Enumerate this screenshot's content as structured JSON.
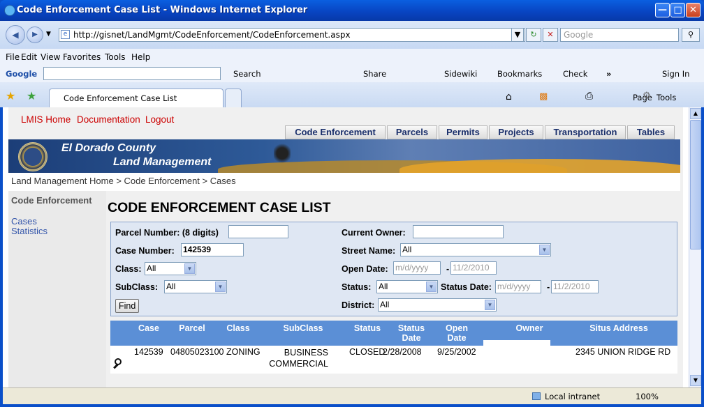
{
  "window": {
    "title": "Code Enforcement Case List - Windows Internet Explorer"
  },
  "address": {
    "url": "http://gisnet/LandMgmt/CodeEnforcement/CodeEnforcement.aspx",
    "search_placeholder": "Google"
  },
  "menu": [
    "File",
    "Edit",
    "View",
    "Favorites",
    "Tools",
    "Help"
  ],
  "google_bar": {
    "logo": "Google",
    "items": [
      "Search",
      "Share",
      "Sidewiki",
      "Bookmarks",
      "Check",
      "»",
      "Sign In"
    ]
  },
  "tab": {
    "title": "Code Enforcement Case List",
    "page_label": "Page",
    "tools_label": "Tools"
  },
  "top_links": [
    "LMIS Home",
    "Documentation",
    "Logout"
  ],
  "nav_tabs": [
    "Code Enforcement",
    "Parcels",
    "Permits",
    "Projects",
    "Transportation",
    "Tables"
  ],
  "banner": {
    "county": "El Dorado County",
    "dept": "Land Management"
  },
  "breadcrumb": "Land Management Home > Code Enforcement > Cases",
  "left_nav": {
    "heading": "Code Enforcement",
    "links": [
      "Cases",
      "Statistics"
    ]
  },
  "page_title": "CODE ENFORCEMENT CASE LIST",
  "form": {
    "parcel_label": "Parcel Number: (8 digits)",
    "parcel_value": "",
    "case_label": "Case Number:",
    "case_value": "142539",
    "class_label": "Class:",
    "class_value": "All",
    "subclass_label": "SubClass:",
    "subclass_value": "All",
    "find_label": "Find",
    "owner_label": "Current Owner:",
    "owner_value": "",
    "street_label": "Street Name:",
    "street_value": "All",
    "open_label": "Open Date:",
    "open_from": "m/d/yyyy",
    "open_to": "11/2/2010",
    "status_label": "Status:",
    "status_value": "All",
    "status_date_label": "Status Date:",
    "status_from": "m/d/yyyy",
    "status_to": "11/2/2010",
    "district_label": "District:",
    "district_value": "All",
    "dash": "-"
  },
  "grid": {
    "headers": [
      "Case",
      "Parcel",
      "Class",
      "SubClass",
      "Status",
      "Status Date",
      "Open Date",
      "Owner",
      "Situs Address"
    ],
    "rows": [
      {
        "case": "142539",
        "parcel": "04805023100",
        "class": "ZONING",
        "subclass": "BUSINESS COMMERCIAL",
        "status": "CLOSED",
        "status_date": "2/28/2008",
        "open_date": "9/25/2002",
        "owner": "",
        "address": "2345 UNION RIDGE RD"
      }
    ]
  },
  "status_bar": {
    "zone": "Local intranet",
    "zoom": "100%"
  }
}
